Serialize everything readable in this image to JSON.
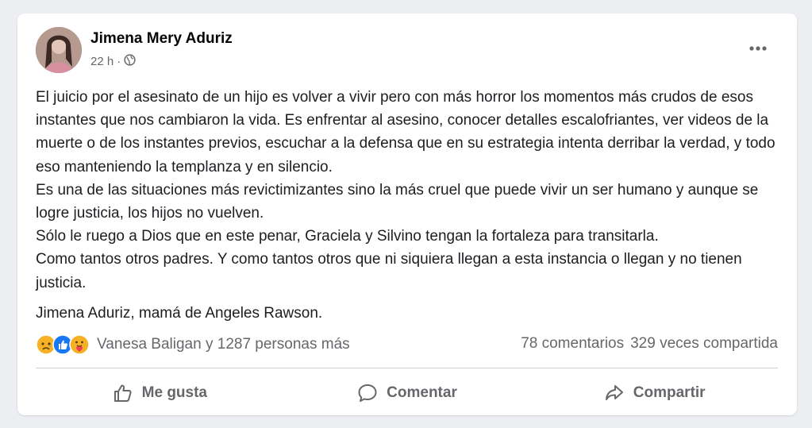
{
  "post": {
    "author": "Jimena Mery Aduriz",
    "time": "22 h",
    "separator": "·",
    "paragraphs": [
      "El juicio por el asesinato de un hijo es volver a vivir pero con más  horror los momentos más crudos de esos instantes que nos cambiaron la vida. Es enfrentar al asesino, conocer detalles escalofriantes, ver videos de la muerte o de los instantes previos, escuchar a la defensa que en su estrategia intenta derribar la verdad, y todo eso manteniendo la templanza y en silencio.",
      "Es una de las situaciones más revictimizantes sino la más cruel que puede vivir un ser humano y aunque se logre justicia, los hijos no vuelven.",
      "Sólo le ruego a Dios que en este penar, Graciela y Silvino tengan la fortaleza para transitarla.",
      "Como tantos otros padres. Y como tantos otros que ni siquiera llegan a esta instancia o llegan y no tienen justicia."
    ],
    "signature": "Jimena Aduriz, mamá de Angeles Rawson."
  },
  "reactions": {
    "icons": [
      "sad-icon",
      "like-icon",
      "care-icon"
    ],
    "summary": "Vanesa Baligan y 1287 personas más"
  },
  "counts": {
    "comments": "78 comentarios",
    "shares": "329 veces compartida"
  },
  "actions": {
    "like": "Me gusta",
    "comment": "Comentar",
    "share": "Compartir"
  },
  "colors": {
    "secondary_text": "#65676b",
    "like_blue": "#1877f2",
    "reaction_yellow": "#f7b125",
    "care_red": "#f33e58"
  }
}
